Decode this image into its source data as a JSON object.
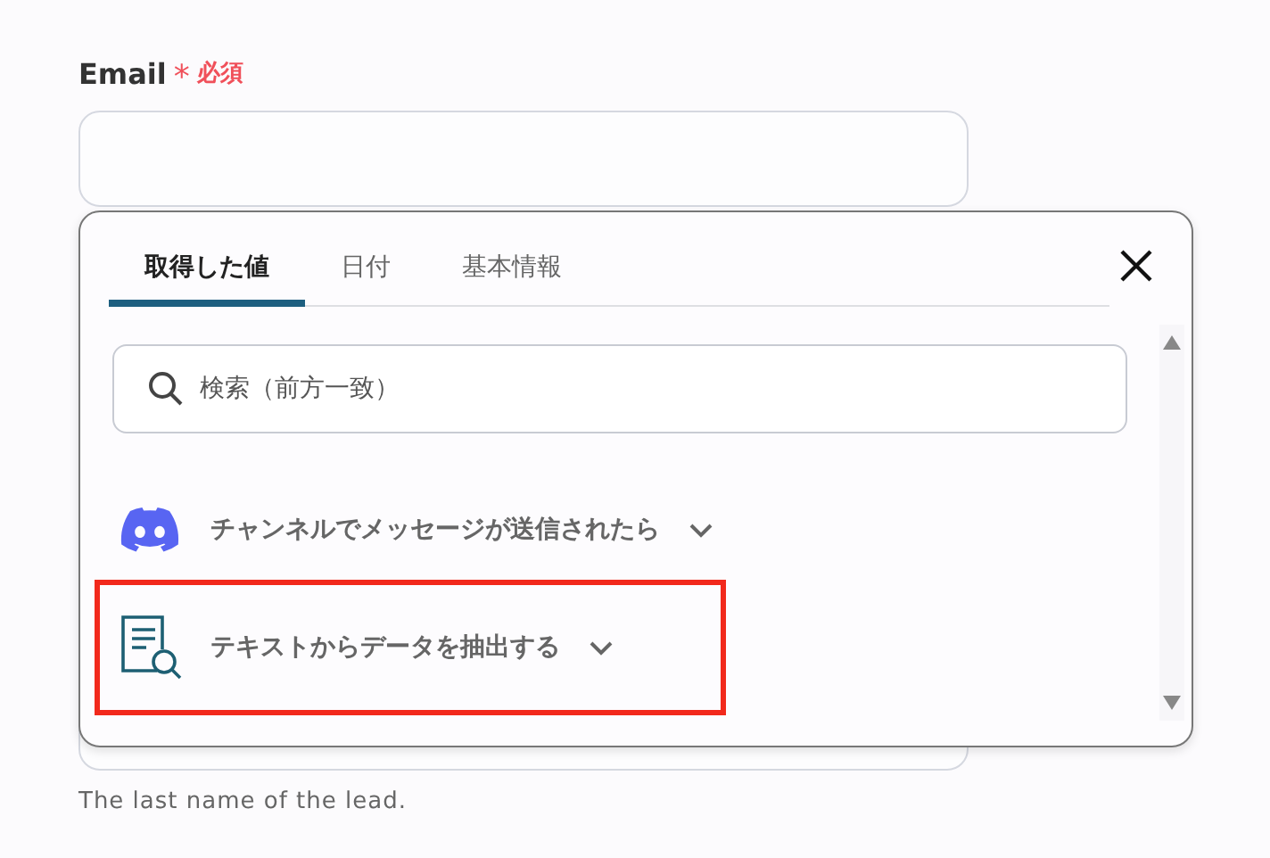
{
  "field": {
    "label": "Email",
    "required_mark": "*",
    "required_text": "必須"
  },
  "hidden_field": {
    "hint": "The last name of the lead."
  },
  "popup": {
    "tabs": [
      {
        "label": "取得した値",
        "selected": true
      },
      {
        "label": "日付",
        "selected": false
      },
      {
        "label": "基本情報",
        "selected": false
      }
    ],
    "search": {
      "placeholder": "検索（前方一致）"
    },
    "items": [
      {
        "kind": "discord",
        "label": "チャンネルでメッセージが送信されたら",
        "highlighted": false
      },
      {
        "kind": "document",
        "label": "テキストからデータを抽出する",
        "highlighted": true
      }
    ]
  }
}
